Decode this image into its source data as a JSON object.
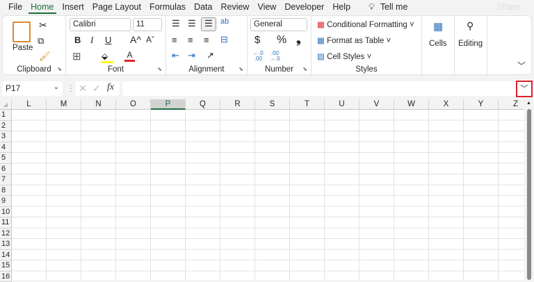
{
  "menu": {
    "items": [
      "File",
      "Home",
      "Insert",
      "Page Layout",
      "Formulas",
      "Data",
      "Review",
      "View",
      "Developer",
      "Help"
    ],
    "tell_me": "Tell me",
    "share": "Share"
  },
  "ribbon": {
    "clipboard": {
      "label": "Clipboard",
      "paste": "Paste"
    },
    "font": {
      "label": "Font",
      "name": "Calibri",
      "size": "11",
      "bold": "B",
      "italic": "I",
      "underline": "U",
      "grow": "A^",
      "shrink": "Aˇ",
      "color_letter": "A",
      "fill_color": "#ffff00",
      "font_color": "#e0212b"
    },
    "alignment": {
      "label": "Alignment"
    },
    "number": {
      "label": "Number",
      "format": "General",
      "currency": "$",
      "percent": "%",
      "comma": "❟",
      "inc": "←.0\n.00",
      "dec": ".00\n→.0"
    },
    "styles": {
      "label": "Styles",
      "conditional": "Conditional Formatting",
      "format_table": "Format as Table",
      "cell_styles": "Cell Styles"
    },
    "cells": {
      "label": "Cells"
    },
    "editing": {
      "label": "Editing"
    }
  },
  "formula_bar": {
    "name_box": "P17",
    "fx": "fx",
    "value": ""
  },
  "sheet": {
    "columns": [
      "L",
      "M",
      "N",
      "O",
      "P",
      "Q",
      "R",
      "S",
      "T",
      "U",
      "V",
      "W",
      "X",
      "Y",
      "Z"
    ],
    "selected_column": "P",
    "rows": [
      "1",
      "2",
      "3",
      "4",
      "5",
      "6",
      "7",
      "8",
      "9",
      "10",
      "11",
      "12",
      "13",
      "14",
      "15",
      "16"
    ]
  }
}
